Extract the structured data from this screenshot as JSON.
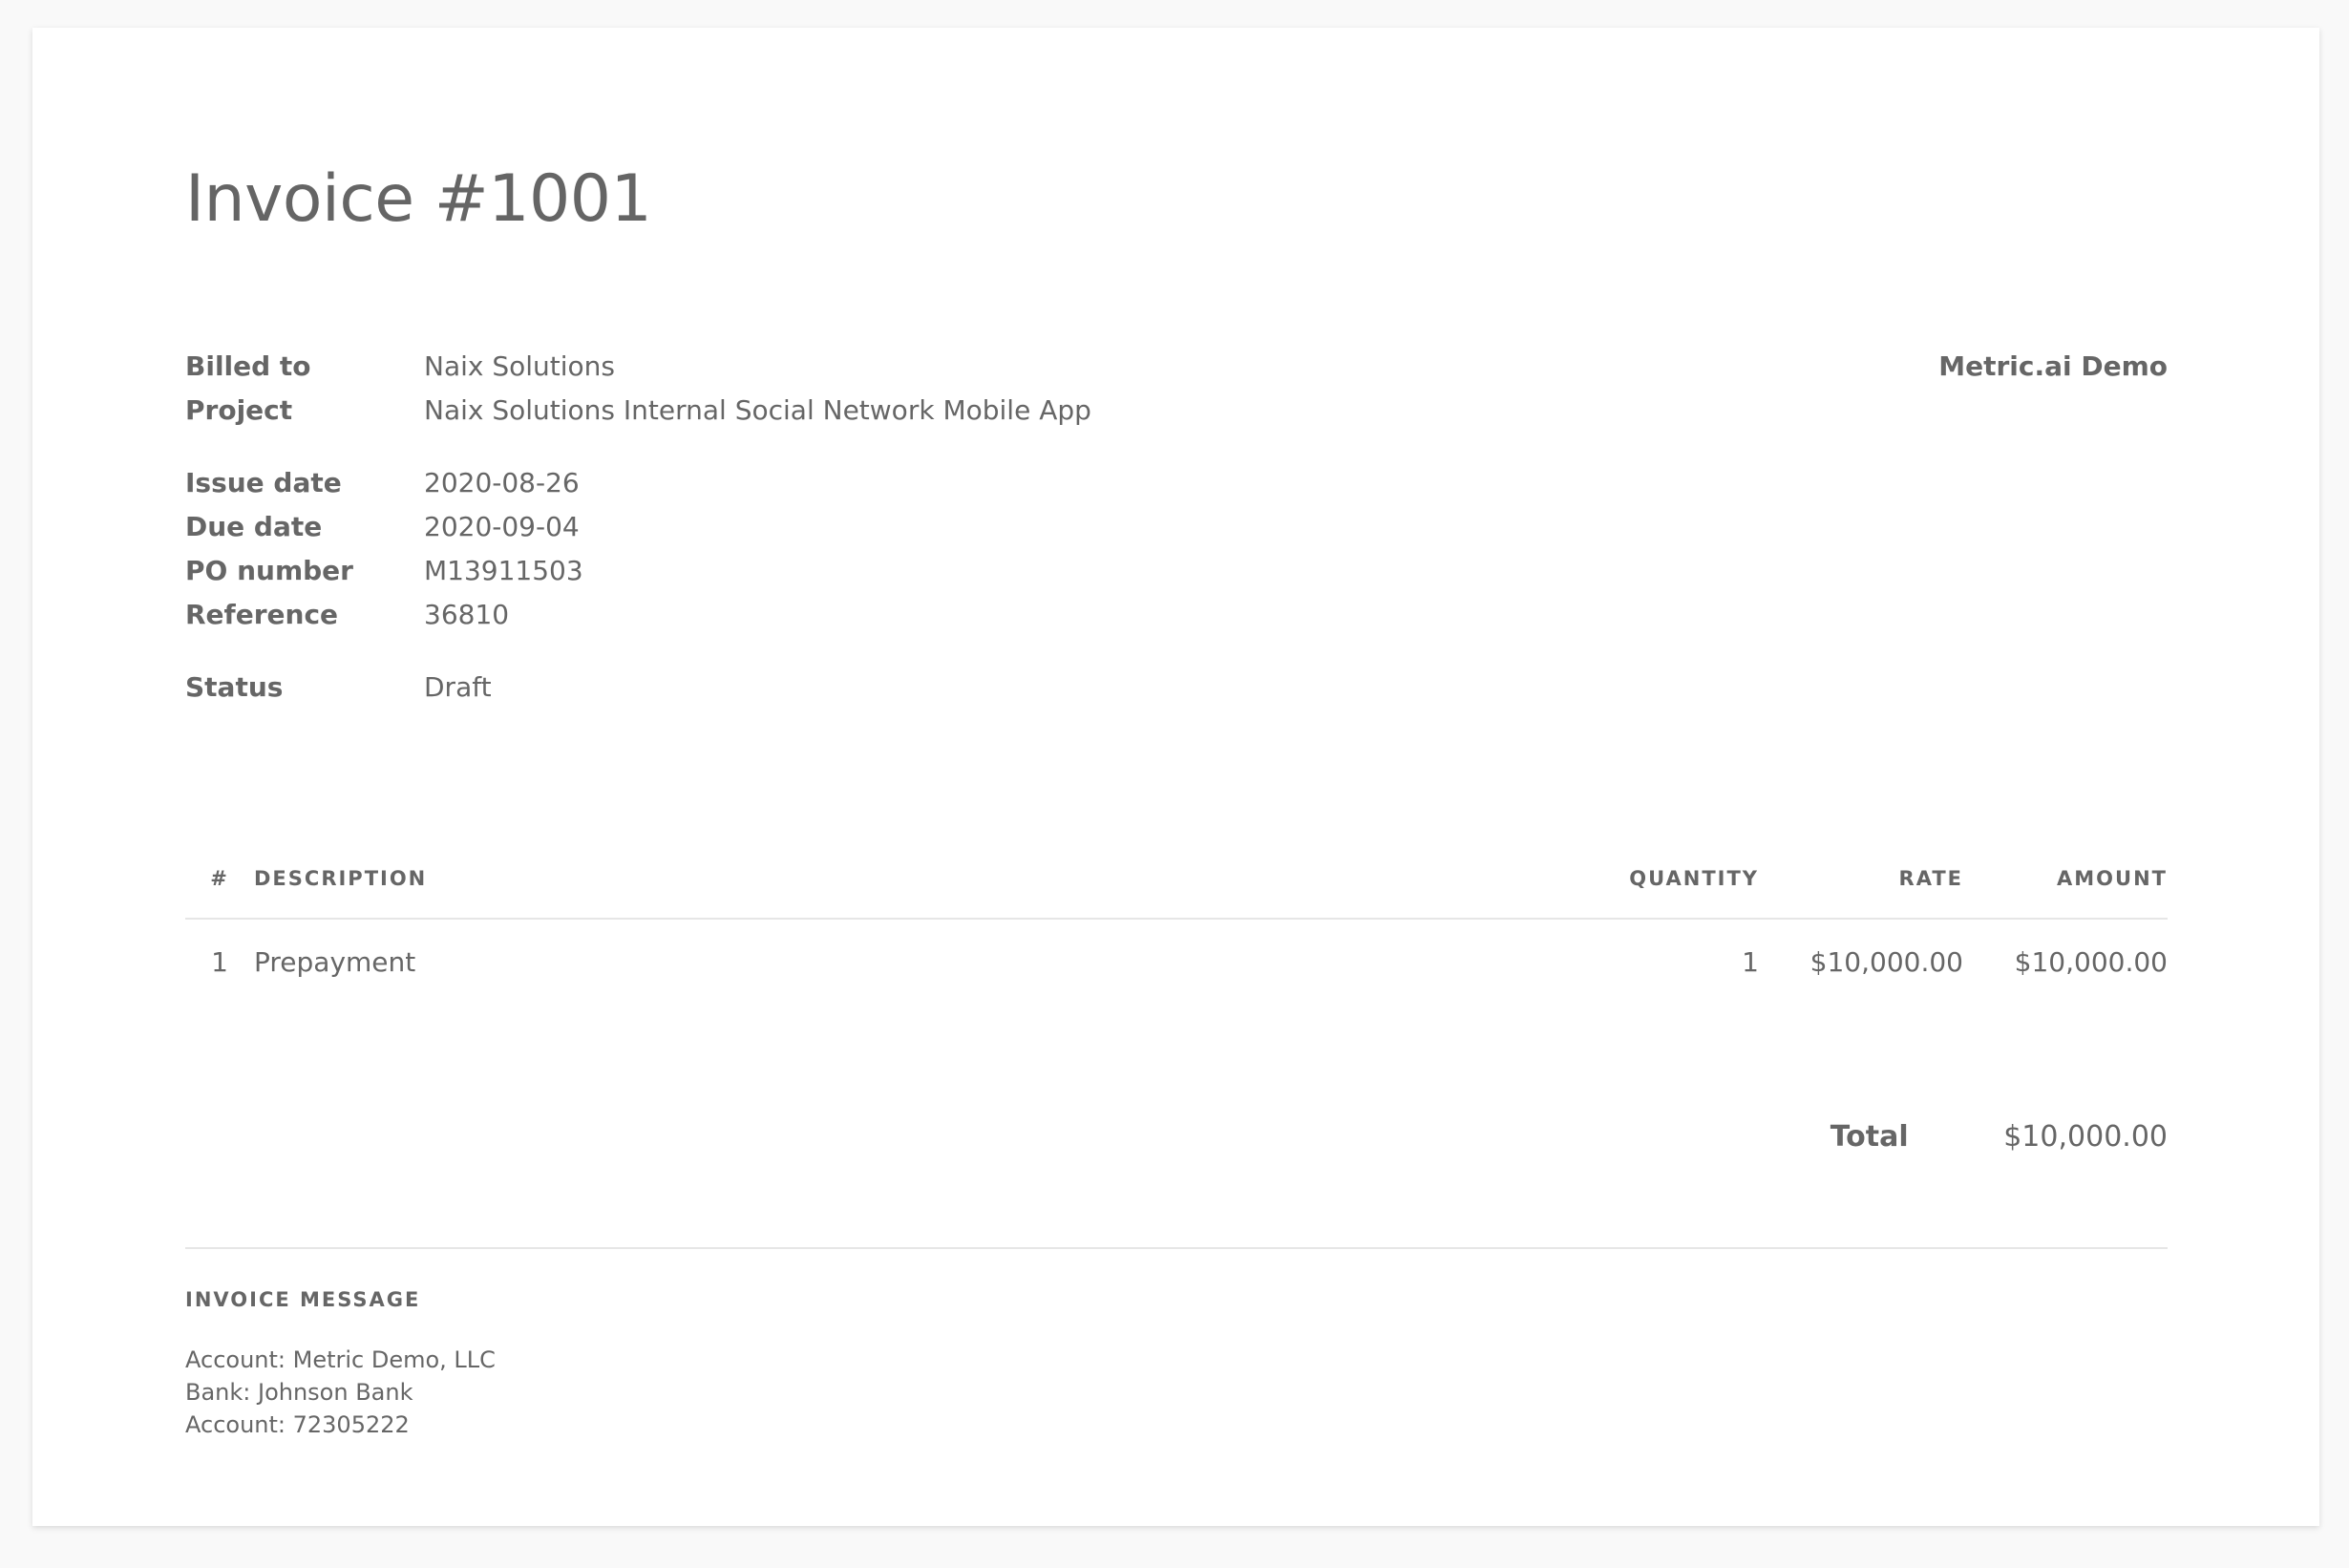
{
  "invoice": {
    "title": "Invoice #1001",
    "company": "Metric.ai Demo"
  },
  "meta": {
    "billed_to": {
      "label": "Billed to",
      "value": "Naix Solutions"
    },
    "project": {
      "label": "Project",
      "value": "Naix Solutions Internal Social Network Mobile App"
    },
    "issue_date": {
      "label": "Issue date",
      "value": "2020-08-26"
    },
    "due_date": {
      "label": "Due date",
      "value": "2020-09-04"
    },
    "po_number": {
      "label": "PO number",
      "value": "M13911503"
    },
    "reference": {
      "label": "Reference",
      "value": "36810"
    },
    "status": {
      "label": "Status",
      "value": "Draft"
    }
  },
  "table": {
    "headers": {
      "num": "#",
      "description": "DESCRIPTION",
      "quantity": "QUANTITY",
      "rate": "RATE",
      "amount": "AMOUNT"
    },
    "rows": [
      {
        "num": "1",
        "description": "Prepayment",
        "quantity": "1",
        "rate": "$10,000.00",
        "amount": "$10,000.00"
      }
    ]
  },
  "total": {
    "label": "Total",
    "value": "$10,000.00"
  },
  "message": {
    "heading": "INVOICE MESSAGE",
    "lines": [
      "Account: Metric Demo, LLC",
      "Bank: Johnson Bank",
      "Account: 72305222"
    ]
  }
}
